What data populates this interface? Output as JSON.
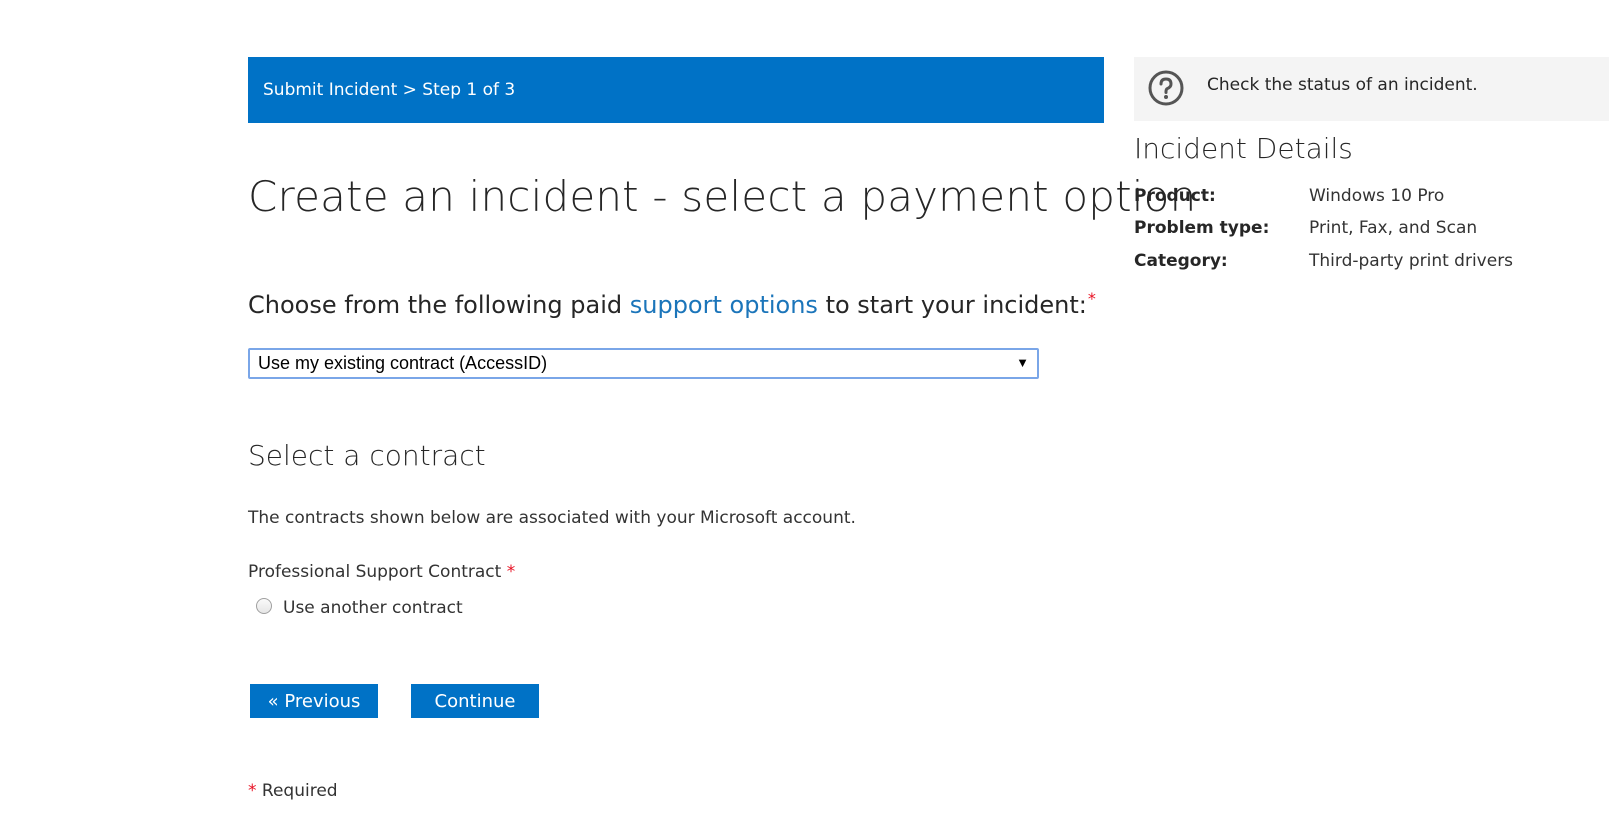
{
  "banner": {
    "text": "Submit Incident > Step 1 of 3"
  },
  "page_title": "Create an incident - select a payment option",
  "payment": {
    "prompt_before": "Choose from the following paid",
    "prompt_link": "support options",
    "prompt_after": "to start your incident:",
    "required_marker": "*",
    "selected_option": "Use my existing contract (AccessID)",
    "caret": "▼"
  },
  "contract_section": {
    "heading": "Select a contract",
    "description": "The contracts shown below are associated with your Microsoft account.",
    "label": "Professional Support Contract",
    "required_marker": "*",
    "radio_option": "Use another contract"
  },
  "buttons": {
    "previous": "« Previous",
    "continue": "Continue"
  },
  "required_note": {
    "marker": "*",
    "text": "Required"
  },
  "sidebar": {
    "status_link": "Check the status of an incident.",
    "details_title": "Incident Details",
    "details": [
      {
        "key": "Product:",
        "value": "Windows 10 Pro"
      },
      {
        "key": "Problem type:",
        "value": "Print, Fax, and Scan"
      },
      {
        "key": "Category:",
        "value": "Third-party print drivers"
      }
    ]
  }
}
